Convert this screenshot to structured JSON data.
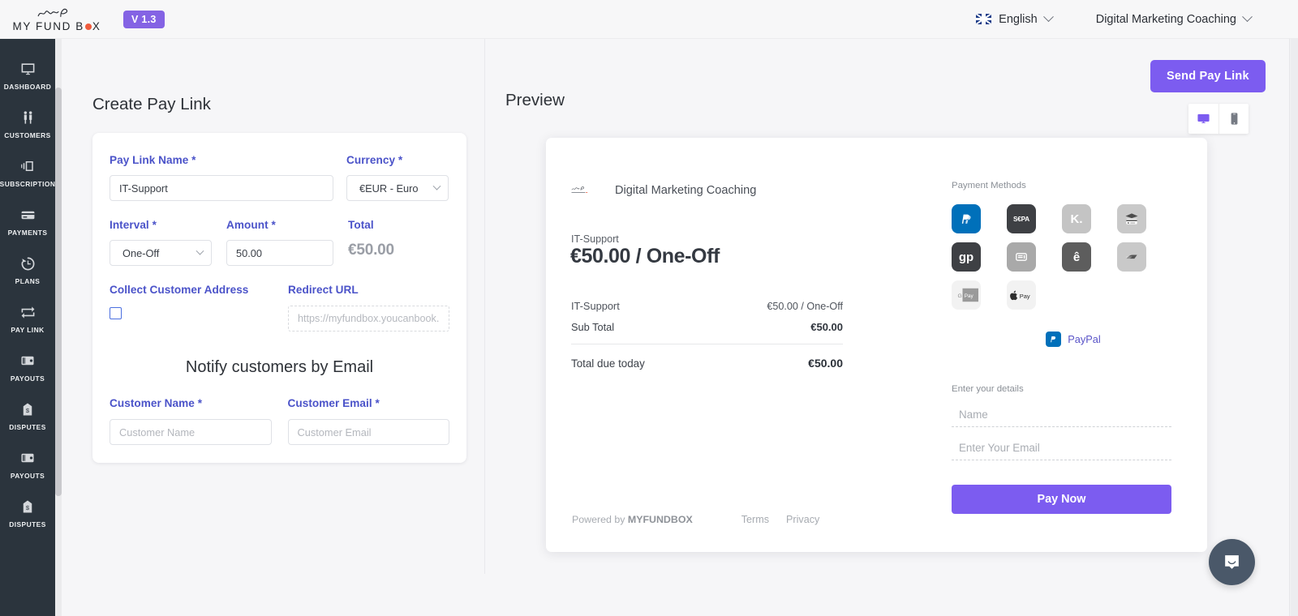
{
  "topbar": {
    "brand_name": "MY FUND B",
    "brand_name_tail": "X",
    "version": "V 1.3",
    "language": "English",
    "account": "Digital Marketing Coaching"
  },
  "sidebar": {
    "items": [
      {
        "label": "DASHBOARD",
        "icon": "monitor-icon"
      },
      {
        "label": "CUSTOMERS",
        "icon": "people-icon"
      },
      {
        "label": "SUBSCRIPTION",
        "icon": "subscription-icon"
      },
      {
        "label": "PAYMENTS",
        "icon": "credit-card-icon"
      },
      {
        "label": "PLANS",
        "icon": "clock-arrow-icon"
      },
      {
        "label": "PAY LINK",
        "icon": "repeat-icon"
      },
      {
        "label": "PAYOUTS",
        "icon": "wallet-icon"
      },
      {
        "label": "DISPUTES",
        "icon": "price-tag-icon"
      },
      {
        "label": "PAYOUTS",
        "icon": "wallet-icon"
      },
      {
        "label": "DISPUTES",
        "icon": "price-tag-icon"
      }
    ]
  },
  "actions": {
    "send_pay_link": "Send Pay Link"
  },
  "form": {
    "title": "Create Pay Link",
    "pay_link_name": {
      "label": "Pay Link Name *",
      "value": "IT-Support"
    },
    "currency": {
      "label": "Currency *",
      "value": "€EUR - Euro"
    },
    "interval": {
      "label": "Interval *",
      "value": "One-Off"
    },
    "amount": {
      "label": "Amount *",
      "value": "50.00"
    },
    "total": {
      "label": "Total",
      "value": "€50.00"
    },
    "collect_address": {
      "label": "Collect Customer Address",
      "checked": false
    },
    "redirect_url": {
      "label": "Redirect URL",
      "value": "",
      "placeholder": "https://myfundbox.youcanbook.n"
    },
    "notify_title": "Notify customers by Email",
    "customer_name": {
      "label": "Customer Name *",
      "value": "",
      "placeholder": "Customer Name"
    },
    "customer_email": {
      "label": "Customer Email *",
      "value": "",
      "placeholder": "Customer Email"
    }
  },
  "preview": {
    "title": "Preview",
    "device_desktop": "desktop-icon",
    "device_mobile": "mobile-icon",
    "merchant": "Digital Marketing Coaching",
    "item_name": "IT-Support",
    "price_headline": "€50.00 / One-Off",
    "lines": [
      {
        "label": "IT-Support",
        "value": "€50.00 / One-Off",
        "bold": false
      },
      {
        "label": "Sub Total",
        "value": "€50.00",
        "bold": true
      }
    ],
    "total_line": {
      "label": "Total due today",
      "value": "€50.00"
    },
    "footer": {
      "powered_prefix": "Powered by ",
      "powered_brand": "MYFUNDBOX",
      "terms": "Terms",
      "privacy": "Privacy"
    },
    "payment_methods_label": "Payment Methods",
    "payment_methods": [
      {
        "name": "paypal-icon",
        "text": "P",
        "bg": "#0070ba",
        "fg": "#ffffff"
      },
      {
        "name": "sepa-icon",
        "text": "S€PA",
        "bg": "#3e4044",
        "fg": "#ffffff"
      },
      {
        "name": "klarna-icon",
        "text": "K.",
        "bg": "#c4c4c4",
        "fg": "#ffffff"
      },
      {
        "name": "card-icon",
        "text": "",
        "bg": "#c9c9c9",
        "fg": "#4c4c4c"
      },
      {
        "name": "giropay-icon",
        "text": "gp",
        "bg": "#3e4044",
        "fg": "#ffffff"
      },
      {
        "name": "przelewy-icon",
        "text": "",
        "bg": "#a9a9a9",
        "fg": "#ffffff"
      },
      {
        "name": "ideal-icon",
        "text": "ê",
        "bg": "#5d5d5d",
        "fg": "#ffffff"
      },
      {
        "name": "bancontact-icon",
        "text": "",
        "bg": "#c9c9c9",
        "fg": "#555555"
      },
      {
        "name": "google-pay-icon",
        "text": "",
        "bg": "#f2f2f2",
        "fg": "#8a8a8a"
      },
      {
        "name": "apple-pay-icon",
        "text": "",
        "bg": "#f2f2f2",
        "fg": "#2e2e2e"
      }
    ],
    "selected_method": {
      "chip": "P",
      "name": "PayPal"
    },
    "details_label": "Enter your details",
    "name_field": {
      "value": "",
      "placeholder": "Name"
    },
    "email_field": {
      "value": "",
      "placeholder": "Enter Your Email"
    },
    "pay_now": "Pay Now"
  },
  "support": {
    "chat": "chat-bubble-icon"
  },
  "colors": {
    "accent": "#7c5cf0",
    "label": "#4b53c9",
    "sidebar": "#2b343d",
    "page_bg": "#f6f6f8"
  }
}
